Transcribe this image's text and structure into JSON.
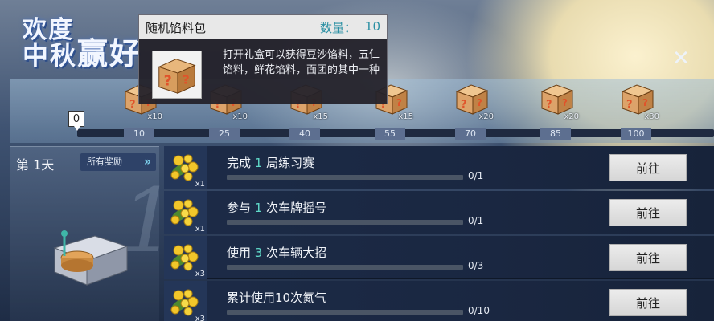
{
  "event_title": {
    "line1": "欢度",
    "line2": "中秋",
    "line2b": "赢好"
  },
  "tooltip": {
    "item_name": "随机馅料包",
    "quantity_label": "数量：",
    "quantity": "10",
    "description": "打开礼盒可以获得豆沙馅料，五仁馅料，鲜花馅料，面团的其中一种"
  },
  "progress": {
    "current": "0",
    "milestones": [
      {
        "label": "10",
        "count": "x10"
      },
      {
        "label": "25",
        "count": "x10"
      },
      {
        "label": "40",
        "count": "x15"
      },
      {
        "label": "55",
        "count": "x15"
      },
      {
        "label": "70",
        "count": "x20"
      },
      {
        "label": "85",
        "count": "x20"
      },
      {
        "label": "100",
        "count": "x30"
      }
    ]
  },
  "day_panel": {
    "day_label": "第 1天",
    "all_rewards_label": "所有奖励",
    "big_number": "1"
  },
  "tasks": [
    {
      "pre": "完成 ",
      "num": "1",
      "post": " 局练习赛",
      "progress": "0/1",
      "reward_count": "x1",
      "button": "前往"
    },
    {
      "pre": "参与 ",
      "num": "1",
      "post": " 次车牌摇号",
      "progress": "0/1",
      "reward_count": "x1",
      "button": "前往"
    },
    {
      "pre": "使用 ",
      "num": "3",
      "post": " 次车辆大招",
      "progress": "0/3",
      "reward_count": "x3",
      "button": "前往"
    },
    {
      "pre": "累计使用10次氮气",
      "num": "",
      "post": "",
      "progress": "0/10",
      "reward_count": "x3",
      "button": "前往"
    }
  ],
  "close_glyph": "✕",
  "colors": {
    "highlight": "#5fd8c8",
    "quantity": "#2a8fa3"
  }
}
